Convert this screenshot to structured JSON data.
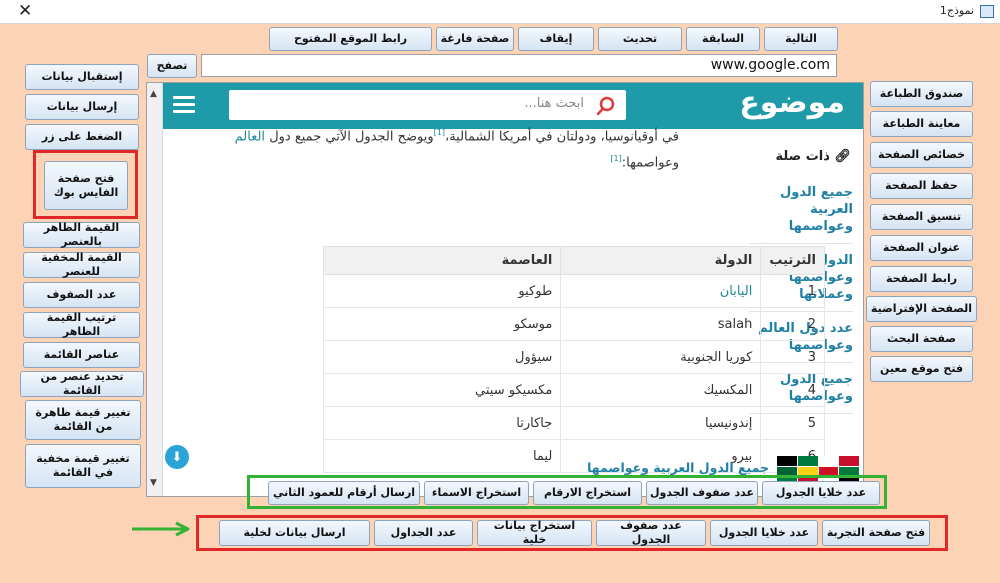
{
  "window": {
    "title": "نموذج1",
    "close_glyph": "✕"
  },
  "top_buttons": [
    "التالية",
    "السابقة",
    "تحديث",
    "إيقاف",
    "صفحة فارغة",
    "رابط الموقع المفتوح"
  ],
  "navigate_button": "تصفح",
  "url": "www.google.com",
  "left_buttons": [
    "إستقبال بيانات",
    "إرسال بيانات",
    "الضغط على زر",
    "فتح صفحة الفايس بوك",
    "القيمة الظاهر بالعنصر",
    "القيمة المخفية للعنصر",
    "عدد الصفوف",
    "ترتيب القيمة الظاهر",
    "عناصر القائمة",
    "تحديد عنصر من القائمة",
    "تغيير قيمة ظاهرة من القائمة",
    "تغيير قيمة مخفية في القائمة"
  ],
  "right_buttons": [
    "صندوق الطباعة",
    "معاينة الطباعة",
    "خصائص الصفحة",
    "حفظ الصفحة",
    "تنسيق الصفحة",
    "عنوان الصفحة",
    "رابط الصفحة",
    "الصفحة الإفتراضية",
    "صفحة البحث",
    "فتح موقع معين"
  ],
  "green_row_buttons": [
    "عدد خلايا الجدول",
    "عدد صفوف الجدول",
    "استخراج الارقام",
    "استخراج الاسماء",
    "ارسال أرقام للعمود الثاني"
  ],
  "red_row_buttons": [
    "فتح صفحة التجربة",
    "عدد خلايا الجدول",
    "عدد صفوف الجدول",
    "استخراج بيانات خلية",
    "عدد الجداول",
    "ارسال بيانات لخلية"
  ],
  "site": {
    "logo": "موضوع",
    "search_placeholder": "ابحث هنا...",
    "intro_line1": "في أوقيانوسيا، ودولتان في أمريكا الشمالية،",
    "intro_sup1": "[1]",
    "intro_line1b": "ويوضح الجدول الآتي جميع دول",
    "intro_link": "العالم",
    "intro_line2": "وعواصمها:",
    "intro_sup2": "[1]",
    "related_title": "ذات صلة",
    "related_items": [
      "جميع الدول العربية وعواصمها",
      "الدول العربية وعواصمها وعملاتها",
      "عدد دول العالم وعواصمها",
      "جميع الدول وعواصمها"
    ],
    "table_headers": [
      "الترتيب",
      "الدولة",
      "العاصمة"
    ],
    "table_rows": [
      [
        "1",
        "اليابان",
        "طوكيو"
      ],
      [
        "2",
        "salah",
        "موسكو"
      ],
      [
        "3",
        "كوريا الجنوبية",
        "سيؤول"
      ],
      [
        "4",
        "المكسيك",
        "مكسيكو سيتي"
      ],
      [
        "5",
        "إندونيسيا",
        "جاكارتا"
      ],
      [
        "6",
        "بيرو",
        "ليما"
      ]
    ],
    "flags_link": "جميع الدول العربية وعواصمها"
  },
  "colors": {
    "form_bg": "#fcd3b4",
    "header_teal": "#1f9aa8",
    "link_blue": "#1f7fa4",
    "highlight_red": "#e02828",
    "highlight_green": "#33b233"
  }
}
